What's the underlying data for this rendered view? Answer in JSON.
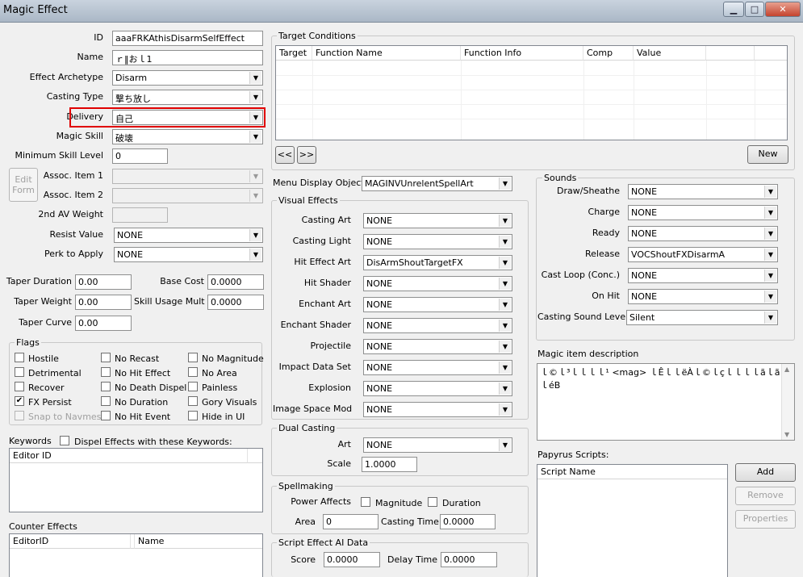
{
  "window": {
    "title": "Magic Effect"
  },
  "general": {
    "id_label": "ID",
    "id_value": "aaaFRKAthisDisarmSelfEffect",
    "name_label": "Name",
    "name_value": "ｒ‖おｌ1",
    "archetype_label": "Effect Archetype",
    "archetype_value": "Disarm",
    "casting_type_label": "Casting Type",
    "casting_type_value": "撃ち放し",
    "delivery_label": "Delivery",
    "delivery_value": "自己",
    "magic_skill_label": "Magic Skill",
    "magic_skill_value": "破壊",
    "min_skill_label": "Minimum Skill Level",
    "min_skill_value": "0",
    "edit_form_label": "Edit Form",
    "assoc1_label": "Assoc. Item 1",
    "assoc1_value": "",
    "assoc2_label": "Assoc. Item 2",
    "assoc2_value": "",
    "second_av_label": "2nd AV Weight",
    "second_av_value": "",
    "resist_label": "Resist Value",
    "resist_value": "NONE",
    "perk_label": "Perk to Apply",
    "perk_value": "NONE",
    "taper_duration_label": "Taper Duration",
    "taper_duration_value": "0.00",
    "taper_weight_label": "Taper Weight",
    "taper_weight_value": "0.00",
    "taper_curve_label": "Taper Curve",
    "taper_curve_value": "0.00",
    "base_cost_label": "Base Cost",
    "base_cost_value": "0.0000",
    "skill_mult_label": "Skill Usage Mult",
    "skill_mult_value": "0.0000"
  },
  "flags": {
    "title": "Flags",
    "items": [
      {
        "label": "Hostile",
        "checked": false,
        "disabled": false
      },
      {
        "label": "No Recast",
        "checked": false,
        "disabled": false
      },
      {
        "label": "No Magnitude",
        "checked": false,
        "disabled": false
      },
      {
        "label": "Detrimental",
        "checked": false,
        "disabled": false
      },
      {
        "label": "No Hit Effect",
        "checked": false,
        "disabled": false
      },
      {
        "label": "No Area",
        "checked": false,
        "disabled": false
      },
      {
        "label": "Recover",
        "checked": false,
        "disabled": false
      },
      {
        "label": "No Death Dispel",
        "checked": false,
        "disabled": false
      },
      {
        "label": "Painless",
        "checked": false,
        "disabled": false
      },
      {
        "label": "FX Persist",
        "checked": true,
        "disabled": false
      },
      {
        "label": "No Duration",
        "checked": false,
        "disabled": false
      },
      {
        "label": "Gory Visuals",
        "checked": false,
        "disabled": false
      },
      {
        "label": "Snap to Navmesh",
        "checked": false,
        "disabled": true
      },
      {
        "label": "No Hit Event",
        "checked": false,
        "disabled": false
      },
      {
        "label": "Hide in UI",
        "checked": false,
        "disabled": false
      }
    ]
  },
  "keywords": {
    "label": "Keywords",
    "dispel_label": "Dispel Effects with these Keywords:",
    "column": "Editor ID"
  },
  "counter": {
    "label": "Counter Effects",
    "col1": "EditorID",
    "col2": "Name"
  },
  "target": {
    "title": "Target Conditions",
    "columns": [
      "Target",
      "Function Name",
      "Function Info",
      "Comp",
      "Value"
    ],
    "prev": "<<",
    "next": ">>",
    "new_label": "New"
  },
  "menu_display": {
    "label": "Menu Display Object",
    "value": "MAGINVUnrelentSpellArt"
  },
  "visual": {
    "title": "Visual Effects",
    "rows": [
      {
        "label": "Casting Art",
        "value": "NONE"
      },
      {
        "label": "Casting Light",
        "value": "NONE"
      },
      {
        "label": "Hit Effect Art",
        "value": "DisArmShoutTargetFX"
      },
      {
        "label": "Hit Shader",
        "value": "NONE"
      },
      {
        "label": "Enchant Art",
        "value": "NONE"
      },
      {
        "label": "Enchant Shader",
        "value": "NONE"
      },
      {
        "label": "Projectile",
        "value": "NONE"
      },
      {
        "label": "Impact Data Set",
        "value": "NONE"
      },
      {
        "label": "Explosion",
        "value": "NONE"
      },
      {
        "label": "Image Space Mod",
        "value": "NONE"
      }
    ]
  },
  "dual": {
    "title": "Dual Casting",
    "art_label": "Art",
    "art_value": "NONE",
    "scale_label": "Scale",
    "scale_value": "1.0000"
  },
  "spellmaking": {
    "title": "Spellmaking",
    "power_label": "Power Affects",
    "magnitude_label": "Magnitude",
    "duration_label": "Duration",
    "area_label": "Area",
    "area_value": "0",
    "casting_time_label": "Casting Time",
    "casting_time_value": "0.0000"
  },
  "script_ai": {
    "title": "Script Effect AI Data",
    "score_label": "Score",
    "score_value": "0.0000",
    "delay_label": "Delay Time",
    "delay_value": "0.0000"
  },
  "sounds": {
    "title": "Sounds",
    "rows": [
      {
        "label": "Draw/Sheathe",
        "value": "NONE"
      },
      {
        "label": "Charge",
        "value": "NONE"
      },
      {
        "label": "Ready",
        "value": "NONE"
      },
      {
        "label": "Release",
        "value": "VOCShoutFXDisarmA"
      },
      {
        "label": "Cast Loop (Conc.)",
        "value": "NONE"
      },
      {
        "label": "On Hit",
        "value": "NONE"
      }
    ],
    "level_label": "Casting Sound Level",
    "level_value": "Silent"
  },
  "description": {
    "label": "Magic item description",
    "value": "ｌ©ｌ³ｌｌｌｌ¹ <mag> ｌÊｌｌëÀｌ©ｌçｌｌｌｌãｌãｌｌéB"
  },
  "papyrus": {
    "label": "Papyrus Scripts:",
    "column": "Script Name",
    "add": "Add",
    "remove": "Remove",
    "properties": "Properties"
  }
}
